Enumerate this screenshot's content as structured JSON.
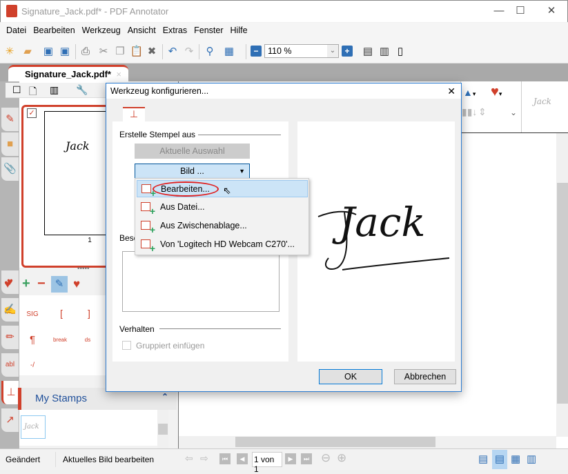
{
  "window": {
    "title": "Signature_Jack.pdf* - PDF Annotator",
    "minimize": "—",
    "maximize": "☐",
    "close": "✕"
  },
  "menu": [
    "Datei",
    "Bearbeiten",
    "Werkzeug",
    "Ansicht",
    "Extras",
    "Fenster",
    "Hilfe"
  ],
  "toolbar": {
    "zoom_value": "110 %"
  },
  "tabs": [
    {
      "label": "Signature_Jack.pdf*",
      "close": "×"
    }
  ],
  "thumbnail": {
    "page_number": "1",
    "signature": "Jack"
  },
  "stamps": {
    "items": [
      "SIG",
      "[",
      "]",
      "¶",
      "break",
      "ds",
      "-/"
    ],
    "section_title": "My Stamps",
    "my_stamp": "Jack"
  },
  "dialog": {
    "title": "Werkzeug konfigurieren...",
    "close": "✕",
    "group_create": "Erstelle Stempel aus",
    "btn_current_selection": "Aktuelle Auswahl",
    "dropdown_label": "Bild ...",
    "dropdown_items": [
      "Bearbeiten...",
      "Aus Datei...",
      "Aus Zwischenablage...",
      "Von 'Logitech HD Webcam C270'..."
    ],
    "desc_label_partial": "Besc",
    "group_behavior": "Verhalten",
    "checkbox_grouped": "Gruppiert einfügen",
    "checkbox_grouped_checked": false,
    "preview_signature": "Jack",
    "ok": "OK",
    "cancel": "Abbrechen"
  },
  "right_toolbar": {
    "stamp_preview": "Jack"
  },
  "status": {
    "left": "Geändert",
    "message": "Aktuelles Bild bearbeiten",
    "page": "1 von 1"
  },
  "colors": {
    "accent": "#d0402b",
    "selection": "#cce4f7",
    "blue": "#2f6fb5"
  }
}
